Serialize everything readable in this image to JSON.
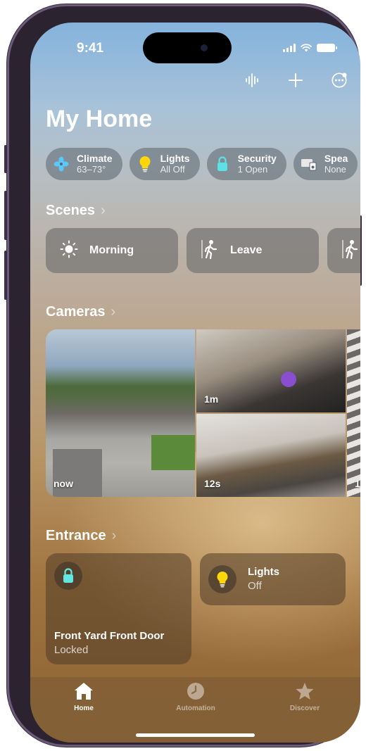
{
  "status_bar": {
    "time": "9:41"
  },
  "header": {
    "title": "My Home"
  },
  "summary_pills": [
    {
      "title": "Climate",
      "subtitle": "63–73°",
      "icon": "fan-icon",
      "color": "#5ac8fa"
    },
    {
      "title": "Lights",
      "subtitle": "All Off",
      "icon": "lightbulb-icon",
      "color": "#ffd60a"
    },
    {
      "title": "Security",
      "subtitle": "1 Open",
      "icon": "lock-icon",
      "color": "#5ce1e6"
    },
    {
      "title": "Spea",
      "subtitle": "None",
      "icon": "speaker-icon",
      "color": "#ffffff"
    }
  ],
  "scenes": {
    "title": "Scenes",
    "items": [
      {
        "label": "Morning",
        "icon": "sun-icon"
      },
      {
        "label": "Leave",
        "icon": "walking-person-icon"
      },
      {
        "label": "",
        "icon": "walking-person-icon"
      }
    ]
  },
  "cameras": {
    "title": "Cameras",
    "items": [
      {
        "name": "front-yard",
        "time": "now"
      },
      {
        "name": "garage-gym",
        "time": "1m"
      },
      {
        "name": "kitchen",
        "time": "12s"
      },
      {
        "name": "stairs",
        "time": "1"
      }
    ]
  },
  "entrance": {
    "title": "Entrance",
    "tiles": [
      {
        "title": "Front Yard Front Door",
        "subtitle": "Locked",
        "icon": "lock-icon",
        "icon_color": "#63e6e2"
      },
      {
        "title": "Lights",
        "subtitle": "Off",
        "icon": "lightbulb-icon",
        "icon_color": "#ffd60a"
      }
    ]
  },
  "tab_bar": {
    "items": [
      {
        "label": "Home",
        "icon": "house-icon",
        "active": true
      },
      {
        "label": "Automation",
        "icon": "clock-icon",
        "active": false
      },
      {
        "label": "Discover",
        "icon": "star-icon",
        "active": false
      }
    ]
  }
}
